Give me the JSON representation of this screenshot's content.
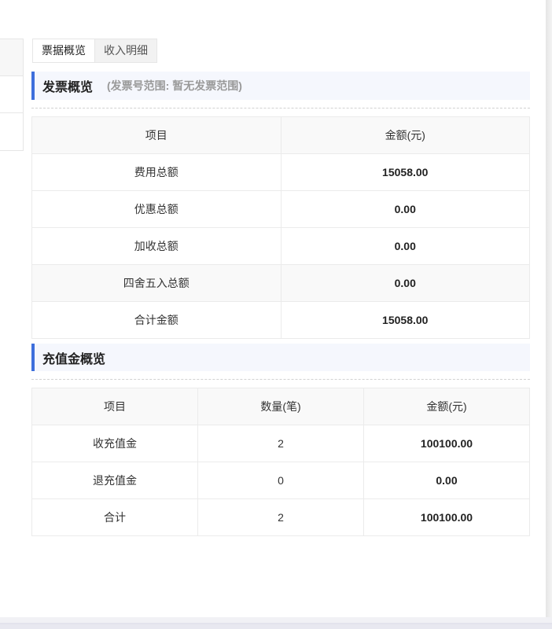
{
  "colors": {
    "accent": "#3e6fdc",
    "section_bg": "#f5f7fd",
    "subtitle": "#999999",
    "border": "#ebebeb",
    "header_bg": "#f9f9f9"
  },
  "tabs": [
    {
      "label": "票据概览",
      "active": true
    },
    {
      "label": "收入明细",
      "active": false
    }
  ],
  "invoice_overview": {
    "title": "发票概览",
    "subtitle": "(发票号范围: 暂无发票范围)",
    "headers": {
      "item": "项目",
      "amount": "金额(元)"
    },
    "rows": [
      {
        "item": "费用总额",
        "amount": "15058.00"
      },
      {
        "item": "优惠总额",
        "amount": "0.00"
      },
      {
        "item": "加收总额",
        "amount": "0.00"
      },
      {
        "item": "四舍五入总额",
        "amount": "0.00",
        "highlighted": true
      },
      {
        "item": "合计金额",
        "amount": "15058.00"
      }
    ]
  },
  "recharge_overview": {
    "title": "充值金概览",
    "headers": {
      "item": "项目",
      "count": "数量(笔)",
      "amount": "金额(元)"
    },
    "rows": [
      {
        "item": "收充值金",
        "count": "2",
        "amount": "100100.00"
      },
      {
        "item": "退充值金",
        "count": "0",
        "amount": "0.00"
      },
      {
        "item": "合计",
        "count": "2",
        "amount": "100100.00"
      }
    ]
  }
}
